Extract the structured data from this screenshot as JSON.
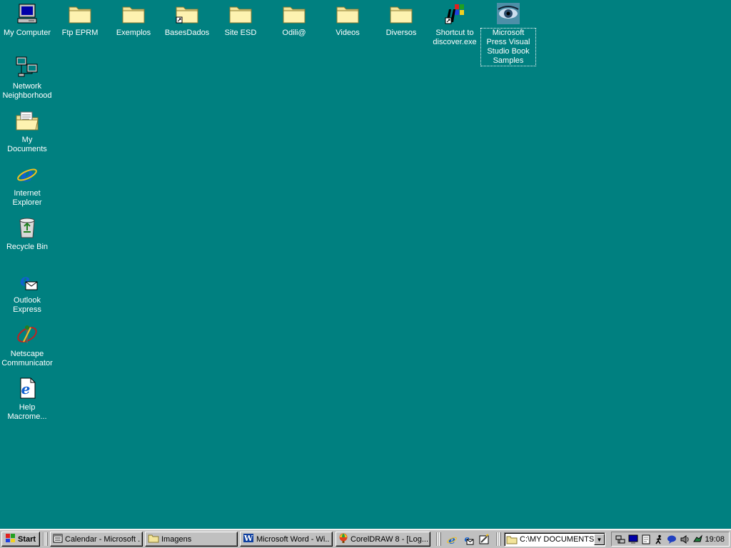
{
  "desktop": {
    "icons": {
      "my_computer": "My Computer",
      "ftp_eprm": "Ftp EPRM",
      "exemplos": "Exemplos",
      "bases_dados": "BasesDados",
      "site_esd": "Site ESD",
      "odili": "Odili@",
      "videos": "Videos",
      "diversos": "Diversos",
      "discover": "Shortcut to discover.exe",
      "ms_press": "Microsoft Press Visual Studio Book Samples",
      "network": "Network Neighborhood",
      "my_documents": "My Documents",
      "internet_explorer": "Internet Explorer",
      "recycle_bin": "Recycle Bin",
      "outlook_express": "Outlook Express",
      "netscape": "Netscape Communicator",
      "help_macromedia": "Help Macrome..."
    },
    "background_color": "#008080"
  },
  "taskbar": {
    "start_label": "Start",
    "tasks": {
      "calendar": "Calendar - Microsoft ...",
      "imagens": "Imagens",
      "word": "Microsoft Word - Wi...",
      "coreldraw": "CorelDRAW 8 - [Log..."
    },
    "address": "C:\\MY DOCUMENTS",
    "clock": "19:08"
  }
}
